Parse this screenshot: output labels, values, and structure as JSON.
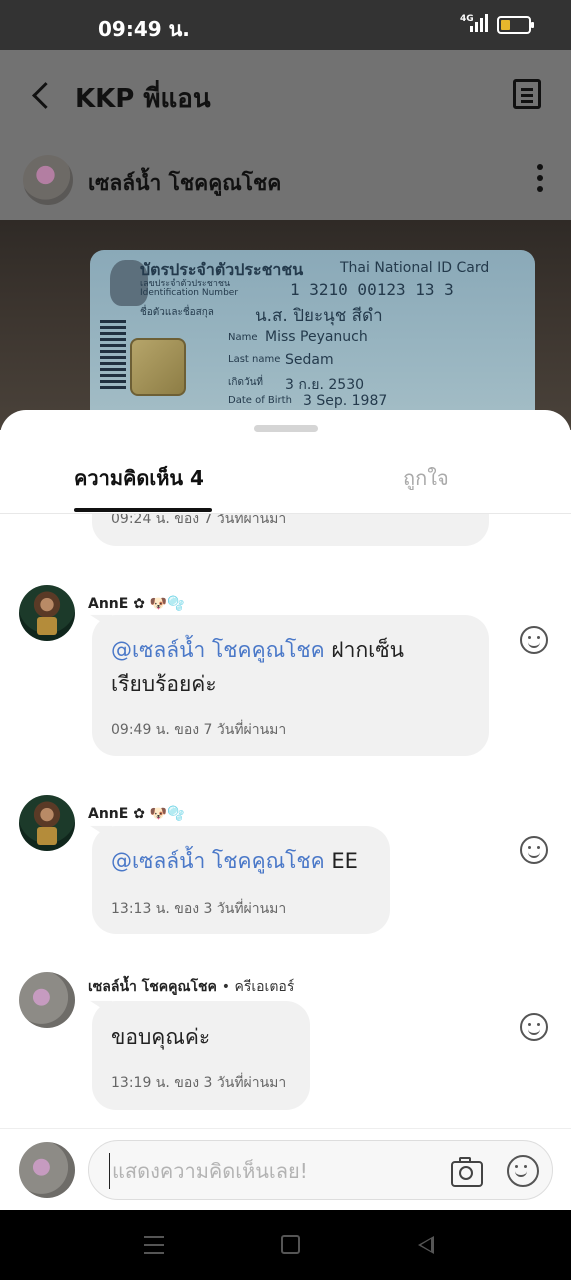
{
  "status_bar": {
    "time": "09:49 น.",
    "network": "4G",
    "battery_level": 0.35,
    "battery_color": "#e7b62c"
  },
  "header": {
    "title": "KKP พี่แอน"
  },
  "post": {
    "author_name": "เซลล์น้ำ โชคคูณโชค"
  },
  "id_card_photo": {
    "title_th": "บัตรประจำตัวประชาชน",
    "title_en": "Thai National ID Card",
    "id_label_th": "เลขประจำตัวประชาชน",
    "id_label_en": "Identification Number",
    "id_number": "1 3210 00123 13 3",
    "name_label_th": "ชื่อตัวและชื่อสกุล",
    "name_th": "น.ส. ปิยะนุช สีดำ",
    "name_label_en": "Name",
    "name_en": "Miss Peyanuch",
    "last_name_label_en": "Last name",
    "last_name_en": "Sedam",
    "dob_label_th": "เกิดวันที่",
    "dob_th": "3 ก.ย. 2530",
    "dob_label_en": "Date of Birth",
    "dob_en": "3 Sep. 1987"
  },
  "sheet": {
    "tabs": [
      {
        "label": "ความคิดเห็น 4",
        "active": true
      },
      {
        "label": "ถูกใจ",
        "active": false
      }
    ],
    "truncated_meta": "09:24 น. ของ 7 วันที่ผ่านมา",
    "comments": [
      {
        "username": "AnnE ✿ 🐶🫧",
        "mention": "@เซลล์น้ำ โชคคูณโชค",
        "text_line1": "ฝากเซ็น",
        "text_line2": "เรียบร้อยค่ะ",
        "meta": "09:49 น. ของ 7 วันที่ผ่านมา"
      },
      {
        "username": "AnnE ✿ 🐶🫧",
        "mention": "@เซลล์น้ำ โชคคูณโชค",
        "text": "EE",
        "meta": "13:13 น. ของ 3 วันที่ผ่านมา"
      },
      {
        "username": "เซลล์น้ำ โชคคูณโชค",
        "role": "• ครีเอเตอร์",
        "text": "ขอบคุณค่ะ",
        "meta": "13:19 น. ของ 3 วันที่ผ่านมา"
      }
    ]
  },
  "composer": {
    "placeholder": "แสดงความคิดเห็นเลย!",
    "value": ""
  },
  "icons": {
    "back": "chevron-left-icon",
    "document": "document-icon",
    "more": "kebab-icon",
    "reaction": "smiley-icon",
    "camera": "camera-icon",
    "nav": [
      "menu-icon",
      "home-icon",
      "back-triangle-icon"
    ]
  },
  "colors": {
    "mention": "#4a78c8",
    "bubble": "#f1f1f1",
    "status_bar": "#333333"
  }
}
